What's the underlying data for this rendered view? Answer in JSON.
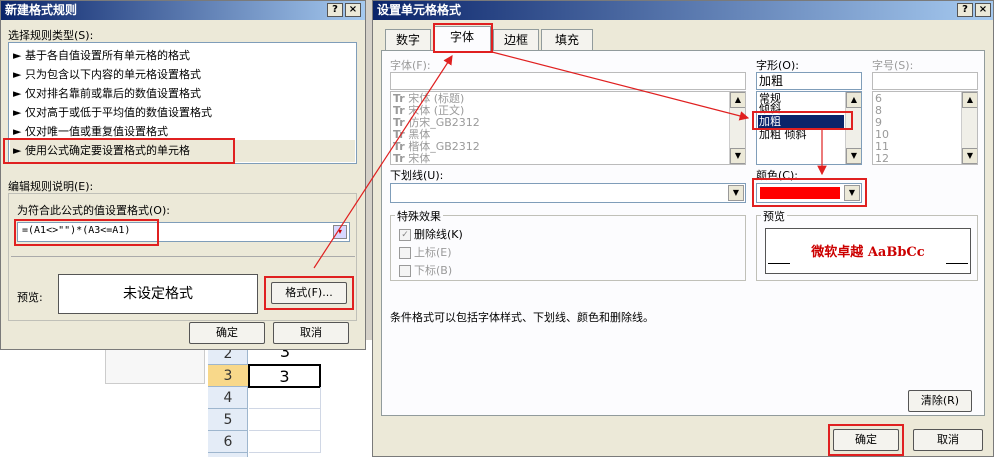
{
  "colors": {
    "title_gradient_start": "#0a246a",
    "title_gradient_end": "#a6caf0",
    "highlight": "#e02020",
    "selected": "#0a246a",
    "preview_text": "#cc0000"
  },
  "left_dialog": {
    "title": "新建格式规则",
    "help_button": "?",
    "close_button": "×",
    "rule_type_label": "选择规则类型(S):",
    "rule_types": [
      "基于各自值设置所有单元格的格式",
      "只为包含以下内容的单元格设置格式",
      "仅对排名靠前或靠后的数值设置格式",
      "仅对高于或低于平均值的数值设置格式",
      "仅对唯一值或重复值设置格式",
      "使用公式确定要设置格式的单元格"
    ],
    "rule_bullet": "►",
    "edit_desc_label": "编辑规则说明(E):",
    "formula_label": "为符合此公式的值设置格式(O):",
    "formula_value": "=(A1<>\"\")*(A3<=A1)",
    "preview_label": "预览:",
    "preview_text": "未设定格式",
    "format_button": "格式(F)...",
    "ok_button": "确定",
    "cancel_button": "取消"
  },
  "spreadsheet": {
    "rows": [
      "2",
      "3",
      "4",
      "5",
      "6"
    ],
    "cell_values": [
      "3",
      "3"
    ]
  },
  "right_dialog": {
    "title": "设置单元格格式",
    "help_button": "?",
    "close_button": "×",
    "tabs": [
      "数字",
      "字体",
      "边框",
      "填充"
    ],
    "font_label": "字体(F):",
    "font_value": "",
    "fonts": [
      "宋体 (标题)",
      "宋体 (正文)",
      "仿宋_GB2312",
      "黑体",
      "楷体_GB2312",
      "宋体"
    ],
    "font_type_icon": "Tr",
    "style_label": "字形(O):",
    "style_value": "加粗",
    "styles": [
      "常规",
      "倾斜",
      "加粗",
      "加粗 倾斜"
    ],
    "size_label": "字号(S):",
    "size_value": "",
    "sizes": [
      "6",
      "8",
      "9",
      "10",
      "11",
      "12"
    ],
    "underline_label": "下划线(U):",
    "underline_value": "",
    "color_label": "颜色(C):",
    "color_value": "#ff0000",
    "effects_label": "特殊效果",
    "effects": [
      {
        "label": "删除线(K)",
        "checked": true
      },
      {
        "label": "上标(E)",
        "checked": false
      },
      {
        "label": "下标(B)",
        "checked": false
      }
    ],
    "check_mark": "✓",
    "preview_label": "预览",
    "preview_text": "微软卓越 AaBbCc",
    "info_text": "条件格式可以包括字体样式、下划线、颜色和删除线。",
    "clear_button": "清除(R)",
    "ok_button": "确定",
    "cancel_button": "取消"
  }
}
